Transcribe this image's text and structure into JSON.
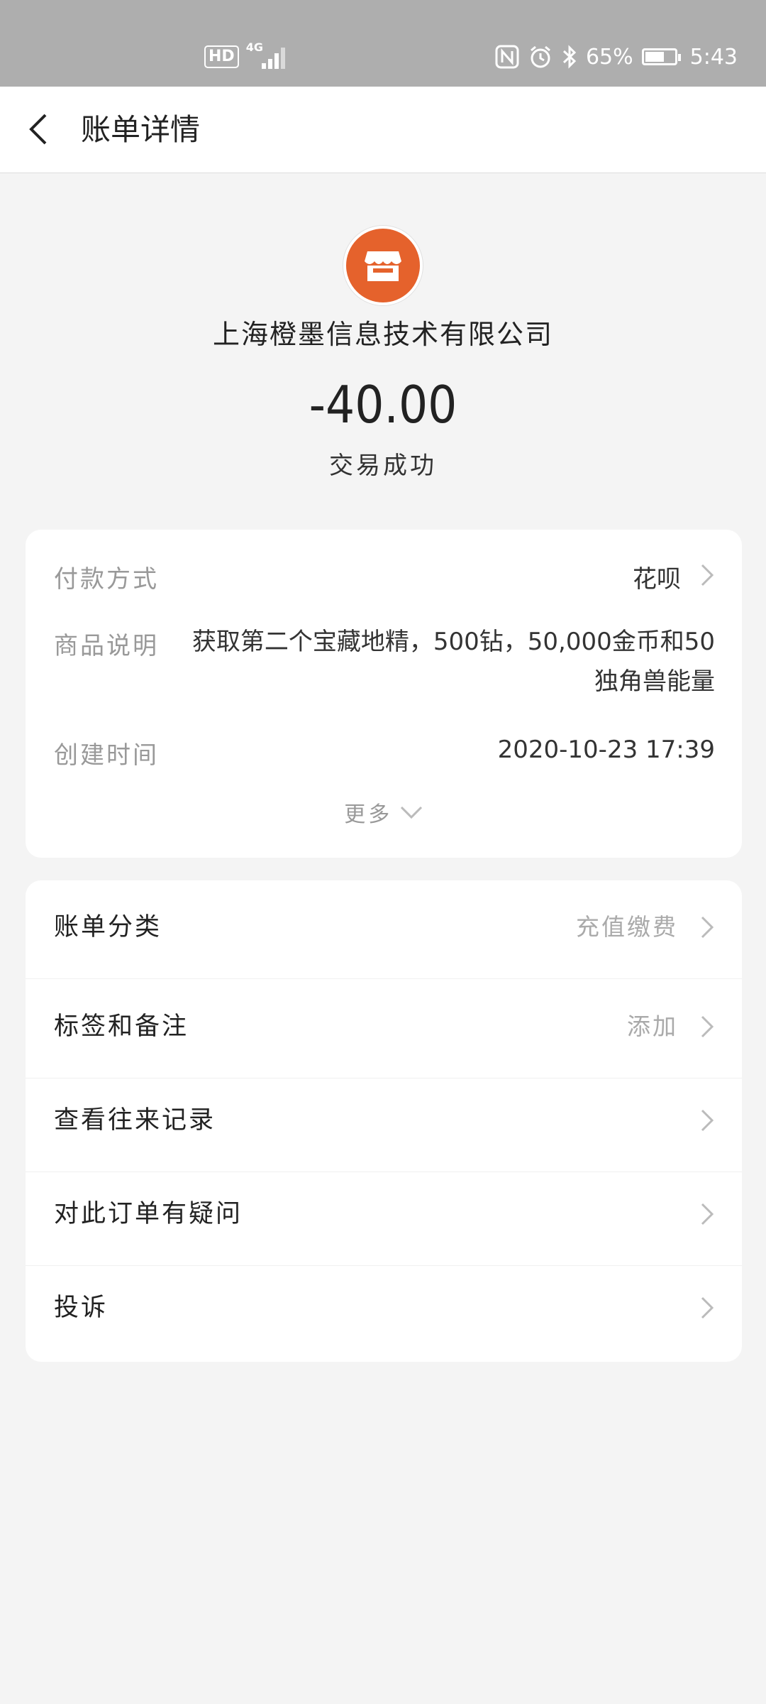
{
  "status_bar": {
    "hd": "HD",
    "network": "4G",
    "battery_text": "65%",
    "battery_level": 0.65,
    "time": "5:43"
  },
  "nav": {
    "title": "账单详情"
  },
  "header": {
    "merchant": "上海橙墨信息技术有限公司",
    "amount": "-40.00",
    "status": "交易成功",
    "logo_color": "#e5622c"
  },
  "details": [
    {
      "label": "付款方式",
      "value": "花呗"
    },
    {
      "label": "商品说明",
      "value_line1": "获取第二个宝藏地精，500钻，50,000金币和50",
      "value_line2": "独角兽能量"
    },
    {
      "label": "创建时间",
      "value": "2020-10-23 17:39"
    }
  ],
  "more_label": "更多",
  "menu": [
    {
      "title": "账单分类",
      "value": "充值缴费"
    },
    {
      "title": "标签和备注",
      "value": "添加"
    },
    {
      "title": "查看往来记录",
      "value": ""
    },
    {
      "title": "对此订单有疑问",
      "value": ""
    },
    {
      "title": "投诉",
      "value": ""
    }
  ]
}
